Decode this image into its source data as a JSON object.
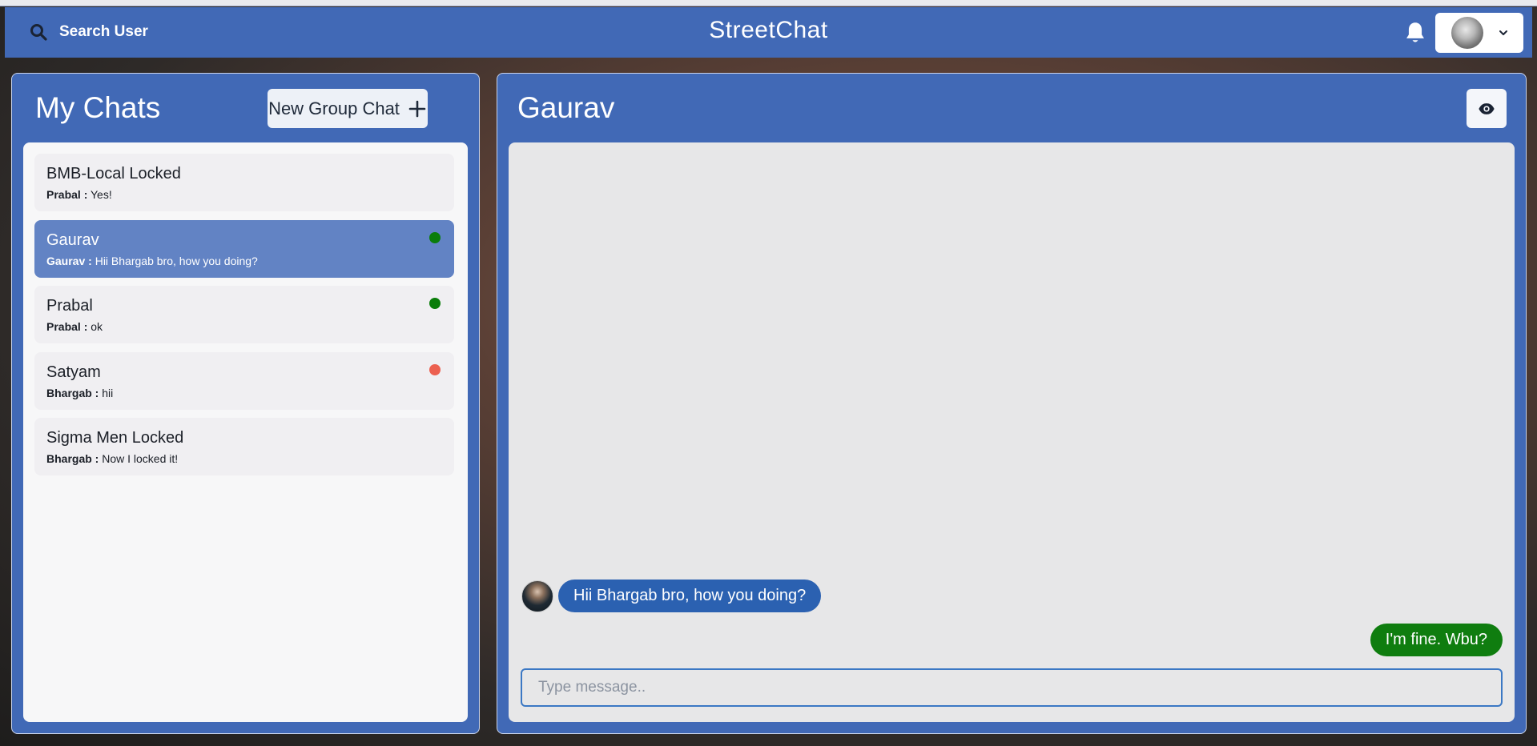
{
  "header": {
    "search_label": "Search User",
    "brand": "StreetChat"
  },
  "sidebar": {
    "title": "My Chats",
    "new_group_label": "New Group Chat",
    "chats": [
      {
        "name": "BMB-Local Locked",
        "sender": "Prabal :",
        "message": "Yes!",
        "status": "none",
        "active": false
      },
      {
        "name": "Gaurav",
        "sender": "Gaurav :",
        "message": "Hii Bhargab bro, how you doing?",
        "status": "#0a7d0a",
        "active": true
      },
      {
        "name": "Prabal",
        "sender": "Prabal :",
        "message": "ok",
        "status": "#0a7d0a",
        "active": false
      },
      {
        "name": "Satyam",
        "sender": "Bhargab :",
        "message": "hii",
        "status": "#ec6050",
        "active": false
      },
      {
        "name": "Sigma Men Locked",
        "sender": "Bhargab :",
        "message": "Now I locked it!",
        "status": "none",
        "active": false
      }
    ]
  },
  "conversation": {
    "title": "Gaurav",
    "messages": [
      {
        "from": "other",
        "text": "Hii Bhargab bro, how you doing?"
      },
      {
        "from": "me",
        "text": "I'm fine. Wbu?"
      }
    ],
    "input_placeholder": "Type message.."
  },
  "icons": {
    "search": "search-icon",
    "bell": "bell-icon",
    "chevron": "chevron-down-icon",
    "plus": "plus-icon",
    "eye": "eye-icon"
  },
  "colors": {
    "primary": "#4169b6",
    "active_chat": "#6283c4",
    "incoming_bubble": "#2b61b1",
    "outgoing_bubble": "#0f7d0f"
  }
}
